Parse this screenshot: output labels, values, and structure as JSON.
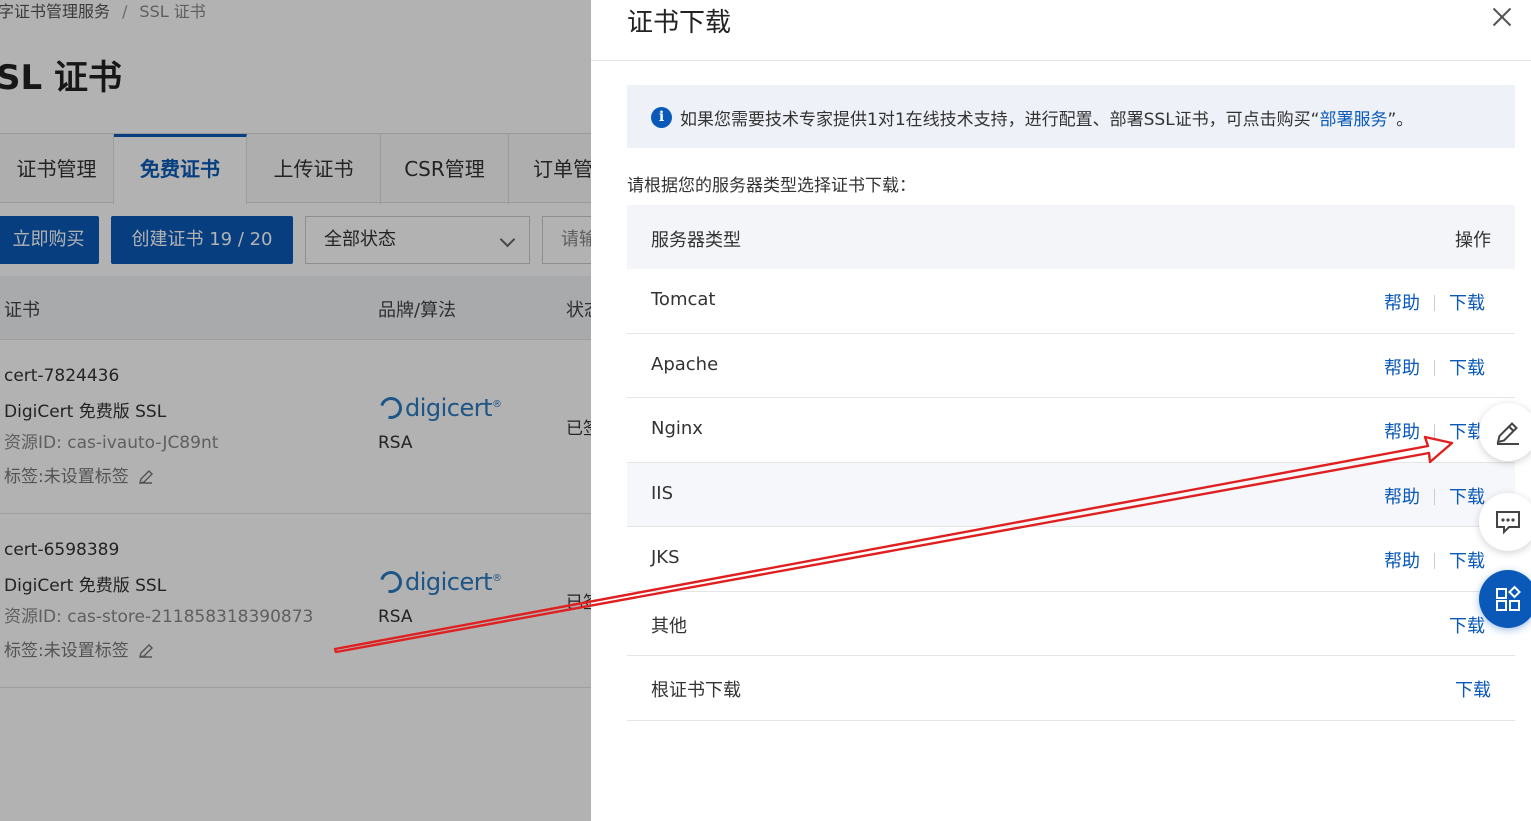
{
  "background": {
    "breadcrumb": {
      "parent": "字证书管理服务",
      "current": "SSL 证书"
    },
    "page_title": "SL 证书",
    "tabs": [
      {
        "label": "证书管理"
      },
      {
        "label": "免费证书",
        "active": true
      },
      {
        "label": "上传证书"
      },
      {
        "label": "CSR管理"
      },
      {
        "label": "订单管"
      }
    ],
    "toolbar": {
      "buy_label": "立即购买",
      "create_label": "创建证书 19 / 20",
      "status_select": "全部状态",
      "search_placeholder": "请输"
    },
    "grid": {
      "headers": {
        "cert": "证书",
        "brand": "品牌/算法",
        "status": "状态"
      },
      "rows": [
        {
          "name": "cert-7824436",
          "product": "DigiCert 免费版 SSL",
          "resource": "资源ID: cas-ivauto-JC89nt",
          "tag": "标签:未设置标签",
          "brand": "digicert",
          "algo": "RSA",
          "status": "已签"
        },
        {
          "name": "cert-6598389",
          "product": "DigiCert 免费版 SSL",
          "resource": "资源ID: cas-store-211858318390873",
          "tag": "标签:未设置标签",
          "brand": "digicert",
          "algo": "RSA",
          "status": "已签"
        }
      ]
    }
  },
  "drawer": {
    "title": "证书下载",
    "notice": {
      "text": "如果您需要技术专家提供1对1在线技术支持，进行配置、部署SSL证书，可点击购买“",
      "link": "部署服务",
      "suffix": "”。"
    },
    "prompt": "请根据您的服务器类型选择证书下载：",
    "table": {
      "header_type": "服务器类型",
      "header_ops": "操作",
      "rows": [
        {
          "name": "Tomcat",
          "help": "帮助",
          "download": "下载"
        },
        {
          "name": "Apache",
          "help": "帮助",
          "download": "下载"
        },
        {
          "name": "Nginx",
          "help": "帮助",
          "download": "下载"
        },
        {
          "name": "IIS",
          "help": "帮助",
          "download": "下载"
        },
        {
          "name": "JKS",
          "help": "帮助",
          "download": "下载"
        },
        {
          "name": "其他",
          "download": "下载"
        },
        {
          "name": "根证书下载",
          "download": "下载"
        }
      ]
    }
  },
  "icons": {
    "close": "close-icon",
    "info": "info-icon",
    "edit": "edit-icon",
    "chat": "chat-icon",
    "apps": "apps-icon",
    "pencil": "pencil-icon"
  },
  "colors": {
    "primary": "#0a59b8",
    "annotation_arrow": "#e02020"
  }
}
